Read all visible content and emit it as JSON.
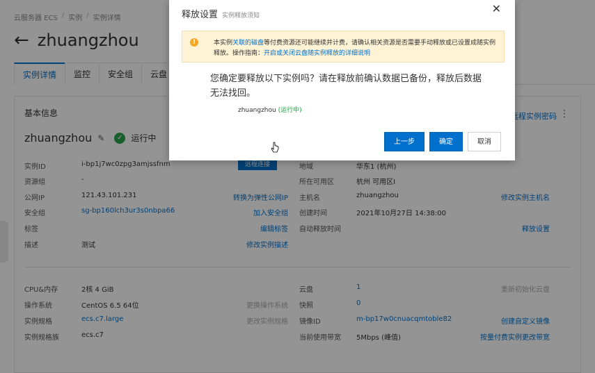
{
  "breadcrumb": [
    "云服务器 ECS",
    "实例",
    "实例详情"
  ],
  "page_title": "zhuangzhou",
  "tabs": [
    "实例详情",
    "监控",
    "安全组",
    "云盘"
  ],
  "basic_info": {
    "section_title": "基本信息",
    "top_right_link": "远程实例密码",
    "instance_name": "zhuangzhou",
    "status": "运行中",
    "remote_connect_button": "远程连接",
    "left_fields": [
      {
        "label": "实例ID",
        "value": "i-bp1j7wc0zpg3amjssfnm",
        "action": ""
      },
      {
        "label": "资源组",
        "value": "-",
        "action": ""
      },
      {
        "label": "公网IP",
        "value": "121.43.101.231",
        "action": "转换为弹性公网IP"
      },
      {
        "label": "安全组",
        "value": "sg-bp160lch3ur3s0nbpa66",
        "action": "加入安全组"
      },
      {
        "label": "标签",
        "value": "",
        "action": "编辑标签"
      },
      {
        "label": "描述",
        "value": "测试",
        "action": "修改实例描述"
      }
    ],
    "right_fields": [
      {
        "label": "地域",
        "value": "华东1 (杭州)",
        "action": ""
      },
      {
        "label": "所在可用区",
        "value": "杭州 可用区I",
        "action": ""
      },
      {
        "label": "主机名",
        "value": "zhuangzhou",
        "action": "修改实例主机名"
      },
      {
        "label": "创建时间",
        "value": "2021年10月27日 14:38:00",
        "action": ""
      },
      {
        "label": "自动释放时间",
        "value": "",
        "action": "释放设置"
      }
    ]
  },
  "config_info": {
    "left_fields": [
      {
        "label": "CPU&内存",
        "value": "2核 4 GiB",
        "action": ""
      },
      {
        "label": "操作系统",
        "value": "CentOS 6.5 64位",
        "action": "更换操作系统"
      },
      {
        "label": "实例规格",
        "value": "ecs.c7.large",
        "action": "更改实例规格"
      },
      {
        "label": "实例规格族",
        "value": "ecs.c7",
        "action": ""
      }
    ],
    "right_fields": [
      {
        "label": "云盘",
        "value": "1",
        "action": "重新初始化云盘"
      },
      {
        "label": "快照",
        "value": "0",
        "action": ""
      },
      {
        "label": "镜像ID",
        "value": "m-bp17w0cnuacqmtoble82",
        "action": "创建自定义镜像"
      },
      {
        "label": "当前使用带宽",
        "value": "5Mbps (峰值)",
        "action": "按量付费实例更改带宽"
      }
    ]
  },
  "modal": {
    "title": "释放设置",
    "subtitle": "实例释放须知",
    "warning_text_1": "本实例",
    "warning_link_1": "关联的磁盘",
    "warning_text_2": "等付费资源还可能继续并计费，请确认相关资源是否需要手动释放或已设置成随实例释放。操作指南：",
    "warning_link_2": "开启或关闭云盘随实例释放的详细说明",
    "confirm_question": "您确定要释放以下实例吗？请在释放前确认数据已备份，释放后数据无法找回。",
    "instance_name": "zhuangzhou",
    "instance_status": "(运行中)",
    "prev_button": "上一步",
    "confirm_button": "确定",
    "cancel_button": "取消"
  },
  "colors": {
    "primary": "#0070cc",
    "warning_bg": "#fff3d6",
    "running_green": "#1a9f3c"
  }
}
